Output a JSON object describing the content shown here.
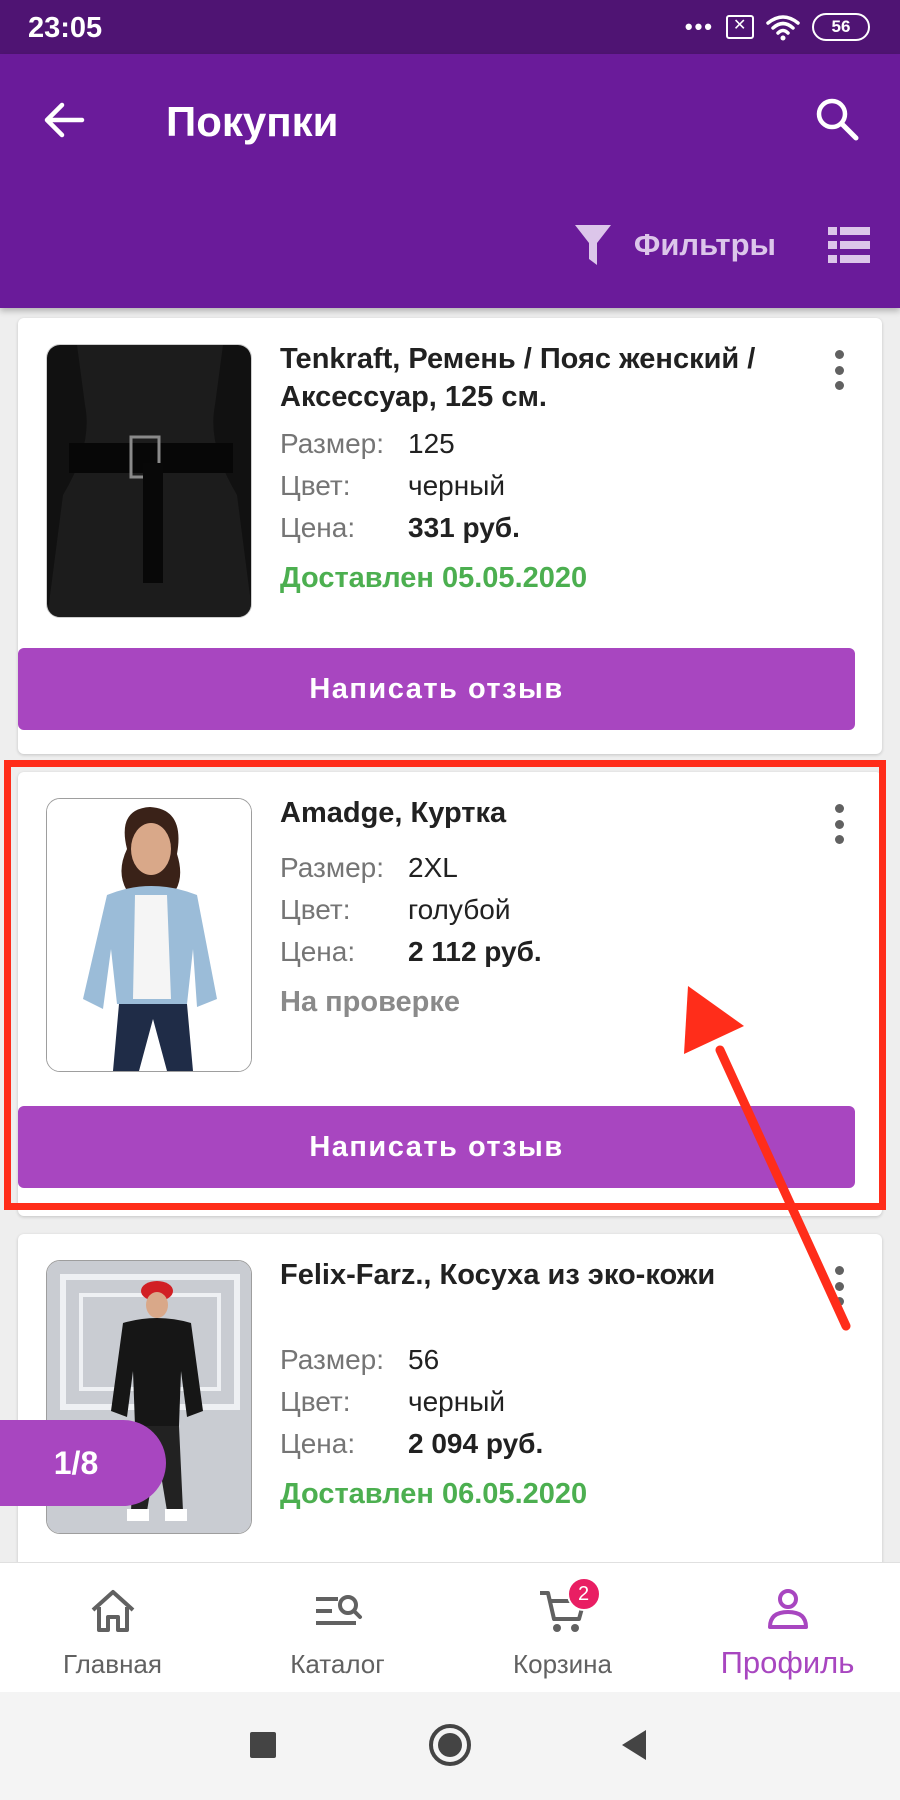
{
  "status_bar": {
    "time": "23:05",
    "dots": "•••",
    "battery": "56"
  },
  "header": {
    "title": "Покупки",
    "filter_label": "Фильтры"
  },
  "products": [
    {
      "name": "Tenkraft, Ремень / Пояс женский / Аксессуар, 125 см.",
      "size_label": "Размер:",
      "size": "125",
      "color_label": "Цвет:",
      "color": "черный",
      "price_label": "Цена:",
      "price": "331 руб.",
      "status": "Доставлен 05.05.2020",
      "review_button": "Написать отзыв"
    },
    {
      "name": "Amadge, Куртка",
      "size_label": "Размер:",
      "size": "2XL",
      "color_label": "Цвет:",
      "color": "голубой",
      "price_label": "Цена:",
      "price": "2 112 руб.",
      "status": "На проверке",
      "review_button": "Написать отзыв"
    },
    {
      "name": "Felix-Farz., Косуха из эко-кожи",
      "size_label": "Размер:",
      "size": "56",
      "color_label": "Цвет:",
      "color": "черный",
      "price_label": "Цена:",
      "price": "2 094 руб.",
      "status": "Доставлен 06.05.2020"
    }
  ],
  "page_counter": "1/8",
  "bottom_nav": {
    "items": [
      {
        "label": "Главная",
        "icon": "home-icon"
      },
      {
        "label": "Каталог",
        "icon": "catalog-search-icon"
      },
      {
        "label": "Корзина",
        "icon": "cart-icon",
        "badge": "2"
      },
      {
        "label": "Профиль",
        "icon": "profile-icon",
        "active": true
      }
    ]
  },
  "colors": {
    "app_bar": "#6a1b9a",
    "status_bar": "#4f1473",
    "accent": "#a846c0",
    "delivered": "#4caf50",
    "annotation": "#ff2d1a",
    "badge": "#e91e63"
  }
}
